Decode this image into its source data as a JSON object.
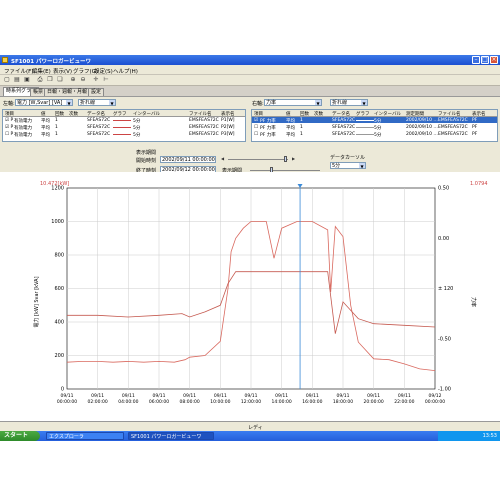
{
  "window": {
    "title": "SF1001 パワーロガービューワ"
  },
  "menu": [
    "ファイル(F)",
    "編集(E)",
    "表示(V)",
    "グラフ(G)",
    "設定(S)",
    "ヘルプ(H)"
  ],
  "tabs": [
    "時系列グラフ",
    "帳票",
    "日報・週報・月報",
    "設定"
  ],
  "left_panel": {
    "element_label": "左軸:",
    "element_value": "電力 [W,Svar] [VA]",
    "mode_value": "折れ線",
    "columns": [
      "項目",
      "値",
      "回数",
      "次数",
      "データ名",
      "グラフ",
      "インターバル",
      "ファイル名",
      "表示名"
    ],
    "rows": [
      {
        "item": "有効電力",
        "val": "平均",
        "count": "1",
        "name": "SFEAS72C",
        "interval": "5分",
        "file": "EMSFEAS72C",
        "disp": "P1[W]"
      },
      {
        "item": "有効電力",
        "val": "平均",
        "count": "1",
        "name": "SFEAS72C",
        "interval": "5分",
        "file": "EMSFEAS72C",
        "disp": "P2[W]"
      },
      {
        "item": "有効電力",
        "val": "平均",
        "count": "1",
        "name": "SFEAS72C",
        "interval": "5分",
        "file": "EMSFEAS72C",
        "disp": "P3[W]"
      }
    ]
  },
  "right_panel": {
    "element_label": "右軸:",
    "element_value": "力率",
    "mode_value": "折れ線",
    "columns": [
      "項目",
      "値",
      "回数",
      "次数",
      "データ名",
      "グラフ",
      "インターバル",
      "測定期間",
      "ファイル名",
      "表示名"
    ],
    "rows": [
      {
        "item": "PF 力率",
        "val": "平均",
        "count": "1",
        "name": "SFEAS72C",
        "interval": "5分",
        "period": "2002/09/10 …",
        "file": "EMSFEAS72C",
        "disp": "PF"
      },
      {
        "item": "PF 力率",
        "val": "平均",
        "count": "1",
        "name": "SFEAS72C",
        "interval": "5分",
        "period": "2002/09/10 …",
        "file": "EMSFEAS72C",
        "disp": "PF"
      },
      {
        "item": "PF 力率",
        "val": "平均",
        "count": "1",
        "name": "SFEAS72C",
        "interval": "5分",
        "period": "2002/09/10 …",
        "file": "EMSFEAS72C",
        "disp": "PF"
      }
    ]
  },
  "controls": {
    "display_period_label": "表示期間",
    "start_label": "開始時刻",
    "start_value": "2002/09/11 00:00:00",
    "end_label": "終了時刻",
    "end_value": "2002/09/12 00:00:00",
    "display_span_label": "表示期間",
    "data_cursor_label": "データカーソル",
    "data_cursor_value": "5分"
  },
  "chart_data": {
    "type": "line",
    "left_top_label": "10.472[kW]",
    "right_top_label": "1.0794",
    "ylabel_left": "電力 [kW] Svar [kVA]",
    "ylabel_right": "力率",
    "yticks_left": [
      "1200",
      "1000",
      "800",
      "600",
      "400",
      "200",
      "0"
    ],
    "yticks_right": [
      "0.50",
      "0.00",
      "± 120",
      "-0.50",
      "-1.00"
    ],
    "x_ticks": [
      [
        "09/11",
        "00:00:00"
      ],
      [
        "09/11",
        "02:00:00"
      ],
      [
        "09/11",
        "04:00:00"
      ],
      [
        "09/11",
        "06:00:00"
      ],
      [
        "09/11",
        "08:00:00"
      ],
      [
        "09/11",
        "10:00:00"
      ],
      [
        "09/11",
        "12:00:00"
      ],
      [
        "09/11",
        "14:00:00"
      ],
      [
        "09/11",
        "16:00:00"
      ],
      [
        "09/11",
        "18:00:00"
      ],
      [
        "09/11",
        "20:00:00"
      ],
      [
        "09/11",
        "22:00:00"
      ],
      [
        "09/12",
        "00:00:00"
      ]
    ],
    "ylim_left": [
      0,
      1200
    ],
    "xlim_hours": [
      0,
      24
    ],
    "cursor_hour": 15.2,
    "series": [
      {
        "values_hours": [
          0,
          1,
          2,
          3,
          4,
          5,
          6,
          7,
          7.7,
          8,
          9,
          10,
          10.5,
          10.7,
          11,
          11.5,
          12,
          13,
          13.5,
          14,
          15,
          16,
          17,
          17.2,
          17.5,
          18,
          18.5,
          19,
          20,
          21,
          22,
          23,
          24
        ],
        "values": [
          160,
          165,
          165,
          160,
          165,
          160,
          165,
          160,
          175,
          190,
          200,
          285,
          600,
          820,
          900,
          960,
          1000,
          1000,
          780,
          960,
          1000,
          1000,
          950,
          580,
          970,
          910,
          500,
          280,
          180,
          175,
          150,
          120,
          110
        ]
      },
      {
        "values_hours": [
          0,
          2,
          4,
          6,
          7.5,
          8,
          9,
          10,
          10.5,
          11,
          12,
          14,
          16,
          17,
          17.5,
          18,
          19,
          20,
          22,
          24
        ],
        "values": [
          440,
          440,
          430,
          440,
          450,
          430,
          460,
          500,
          630,
          700,
          700,
          700,
          700,
          700,
          330,
          520,
          420,
          390,
          380,
          370
        ]
      }
    ]
  },
  "status": {
    "text": "レディ"
  },
  "taskbar": {
    "start": "スタート",
    "items": [
      "エクスプローラ",
      "SF1001 パワーロガービューワ"
    ],
    "clock": "13:53"
  }
}
